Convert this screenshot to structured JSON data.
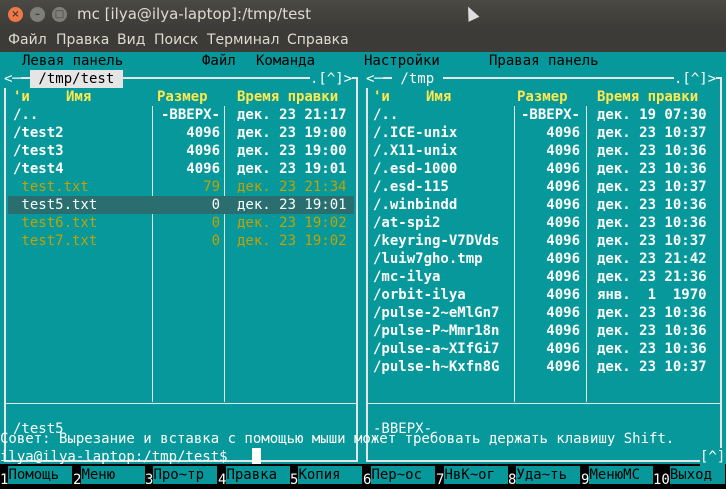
{
  "window": {
    "title": "mc [ilya@ilya-laptop]:/tmp/test"
  },
  "menubar": [
    "Файл",
    "Правка",
    "Вид",
    "Поиск",
    "Терминал",
    "Справка"
  ],
  "mc_menu": [
    "Левая панель",
    "Файл",
    "Команда",
    "Настройки",
    "Правая панель"
  ],
  "left_panel": {
    "path": " /tmp/test ",
    "corner": ".[^]>",
    "headers": {
      "n": "'и",
      "name": "Имя",
      "size": "Размер",
      "mtime": "Время правки"
    },
    "rows": [
      {
        "name": "/..",
        "size": "-ВВЕРХ-",
        "mtime": "дек. 23 21:17",
        "kind": "dir"
      },
      {
        "name": "/test2",
        "size": "4096",
        "mtime": "дек. 23 19:00",
        "kind": "dir"
      },
      {
        "name": "/test3",
        "size": "4096",
        "mtime": "дек. 23 19:00",
        "kind": "dir"
      },
      {
        "name": "/test4",
        "size": "4096",
        "mtime": "дек. 23 19:01",
        "kind": "dir"
      },
      {
        "name": " test.txt",
        "size": "79",
        "mtime": "дек. 23 21:34",
        "kind": "file"
      },
      {
        "name": " test5.txt",
        "size": "0",
        "mtime": "дек. 23 19:01",
        "kind": "selected"
      },
      {
        "name": " test6.txt",
        "size": "0",
        "mtime": "дек. 23 19:02",
        "kind": "file"
      },
      {
        "name": " test7.txt",
        "size": "0",
        "mtime": "дек. 23 19:02",
        "kind": "file"
      }
    ],
    "status": "/test5"
  },
  "right_panel": {
    "path": " /tmp ",
    "corner": ".[^]>",
    "headers": {
      "n": "'и",
      "name": "Имя",
      "size": "Размер",
      "mtime": "Время правки"
    },
    "rows": [
      {
        "name": "/..",
        "size": "-ВВЕРХ-",
        "mtime": "дек. 19 07:30"
      },
      {
        "name": "/.ICE-unix",
        "size": "4096",
        "mtime": "дек. 23 10:37"
      },
      {
        "name": "/.X11-unix",
        "size": "4096",
        "mtime": "дек. 23 10:36"
      },
      {
        "name": "/.esd-1000",
        "size": "4096",
        "mtime": "дек. 23 10:36"
      },
      {
        "name": "/.esd-115",
        "size": "4096",
        "mtime": "дек. 23 10:37"
      },
      {
        "name": "/.winbindd",
        "size": "4096",
        "mtime": "дек. 23 10:36"
      },
      {
        "name": "/at-spi2",
        "size": "4096",
        "mtime": "дек. 23 10:36"
      },
      {
        "name": "/keyring-V7DVds",
        "size": "4096",
        "mtime": "дек. 23 10:37"
      },
      {
        "name": "/luiw7gho.tmp",
        "size": "4096",
        "mtime": "дек. 23 21:42"
      },
      {
        "name": "/mc-ilya",
        "size": "4096",
        "mtime": "дек. 23 21:36"
      },
      {
        "name": "/orbit-ilya",
        "size": "4096",
        "mtime": "янв.  1  1970"
      },
      {
        "name": "/pulse-2~eMlGn7",
        "size": "4096",
        "mtime": "дек. 23 10:36"
      },
      {
        "name": "/pulse-P~Mmr18n",
        "size": "4096",
        "mtime": "дек. 23 10:36"
      },
      {
        "name": "/pulse-a~XIfGi7",
        "size": "4096",
        "mtime": "дек. 23 10:36"
      },
      {
        "name": "/pulse-h~Kxfn8G",
        "size": "4096",
        "mtime": "дек. 23 10:37"
      }
    ],
    "status": "-ВВЕРХ-"
  },
  "tip": "Совет: Вырезание и вставка с помощью мыши может требовать держать клавишу Shift.",
  "prompt": "ilya@ilya-laptop:/tmp/test$",
  "history_btn": "[^]",
  "fkeys": [
    {
      "n": "1",
      "label": "Помощь"
    },
    {
      "n": "2",
      "label": "Меню"
    },
    {
      "n": "3",
      "label": "Про~тр"
    },
    {
      "n": "4",
      "label": "Правка"
    },
    {
      "n": "5",
      "label": "Копия"
    },
    {
      "n": "6",
      "label": "Пер~ос"
    },
    {
      "n": "7",
      "label": "НвК~ог"
    },
    {
      "n": "8",
      "label": "Уда~ть"
    },
    {
      "n": "9",
      "label": "МенюМС"
    },
    {
      "n": "10",
      "label": "Выход"
    }
  ],
  "colors": {
    "cyan": "#06989a",
    "yellow": "#fce94f",
    "file": "#c4a000"
  }
}
